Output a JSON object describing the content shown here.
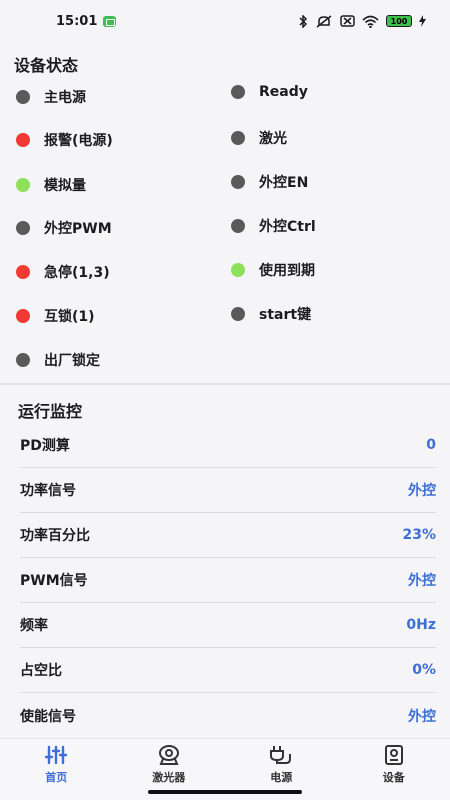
{
  "status_bar": {
    "time": "15:01",
    "battery": "100"
  },
  "device_status": {
    "title": "设备状态",
    "items": [
      {
        "label": "主电源",
        "color": "#5a5a5a"
      },
      {
        "label": "Ready",
        "color": "#5a5a5a"
      },
      {
        "label": "报警(电源)",
        "color": "#f03b35"
      },
      {
        "label": "激光",
        "color": "#5a5a5a"
      },
      {
        "label": "模拟量",
        "color": "#8ee05a"
      },
      {
        "label": "外控EN",
        "color": "#5a5a5a"
      },
      {
        "label": "外控PWM",
        "color": "#5a5a5a"
      },
      {
        "label": "外控Ctrl",
        "color": "#5a5a5a"
      },
      {
        "label": "急停(1,3)",
        "color": "#f03b35"
      },
      {
        "label": "使用到期",
        "color": "#8ee05a"
      },
      {
        "label": "互锁(1)",
        "color": "#f03b35"
      },
      {
        "label": "start键",
        "color": "#5a5a5a"
      },
      {
        "label": "出厂锁定",
        "color": "#5a5a5a"
      }
    ]
  },
  "monitor": {
    "title": "运行监控",
    "rows": [
      {
        "label": "PD测算",
        "value": "0"
      },
      {
        "label": "功率信号",
        "value": "外控"
      },
      {
        "label": "功率百分比",
        "value": "23%"
      },
      {
        "label": "PWM信号",
        "value": "外控"
      },
      {
        "label": "频率",
        "value": "0Hz"
      },
      {
        "label": "占空比",
        "value": "0%"
      },
      {
        "label": "使能信号",
        "value": "外控"
      }
    ]
  },
  "tabs": [
    {
      "label": "首页",
      "icon": "sliders-icon",
      "active": true
    },
    {
      "label": "激光器",
      "icon": "laser-icon",
      "active": false
    },
    {
      "label": "电源",
      "icon": "power-plug-icon",
      "active": false
    },
    {
      "label": "设备",
      "icon": "device-icon",
      "active": false
    }
  ],
  "colors": {
    "accent": "#3d6fd6",
    "red": "#f03b35",
    "green": "#8ee05a",
    "gray": "#5a5a5a"
  }
}
